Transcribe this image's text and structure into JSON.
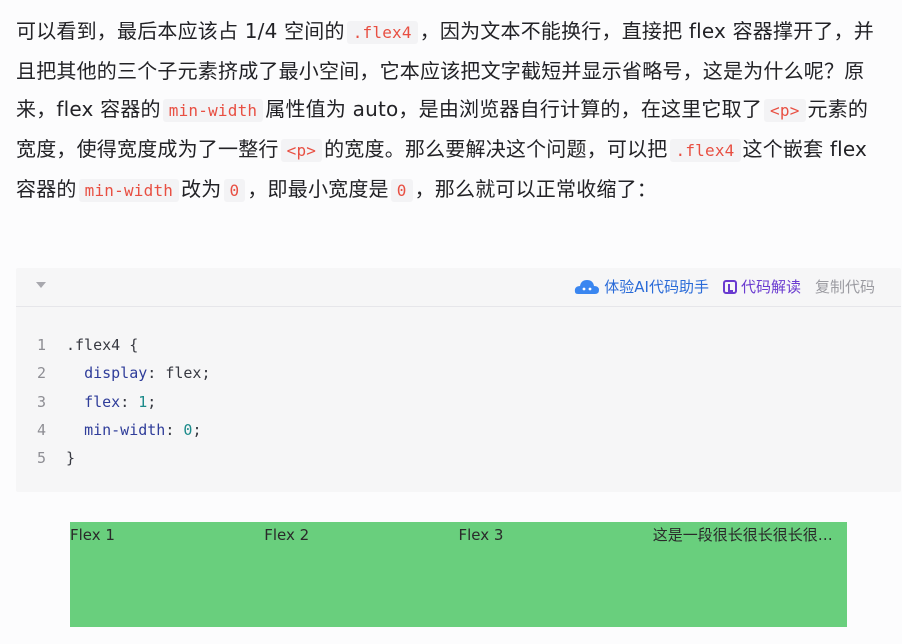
{
  "paragraph": {
    "t1": "可以看到，最后本应该占 1/4 空间的",
    "c1": ".flex4",
    "t2": "，因为文本不能换行，直接把 flex 容器撑开了，并且把其他的三个子元素挤成了最小空间，它本应该把文字截短并显示省略号，这是为什么呢？原来，flex 容器的",
    "c2": "min-width",
    "t3": "属性值为 auto，是由浏览器自行计算的，在这里它取了",
    "c3": "<p>",
    "t4": "元素的宽度，使得宽度成为了一整行",
    "c4": "<p>",
    "t5": "的宽度。那么要解决这个问题，可以把",
    "c5": ".flex4",
    "t6": "这个嵌套 flex 容器的",
    "c6": "min-width",
    "t7": "改为",
    "c7": "0",
    "t8": "，即最小宽度是",
    "c8": "0",
    "t9": "，那么就可以正常收缩了："
  },
  "code_toolbar": {
    "ai_label": "体验AI代码助手",
    "explain_label": "代码解读",
    "copy_label": "复制代码",
    "icons": [
      "chevron-down-icon",
      "cloud-ai-icon",
      "code-explain-icon"
    ]
  },
  "code": {
    "numbers": [
      "1",
      "2",
      "3",
      "4",
      "5"
    ],
    "l1_sel": ".flex4 {",
    "l2_prop": "display",
    "l2_val": "flex",
    "l3_prop": "flex",
    "l3_val": "1",
    "l4_prop": "min-width",
    "l4_val": "0",
    "l5": "}"
  },
  "demo": {
    "items": [
      "Flex 1",
      "Flex 2",
      "Flex 3",
      "这是一段很长很长很长很长很长很长很长很长很长很长很长很长很长很长很长很长很长很长很长很长的文本"
    ],
    "background": "#69cf7d"
  },
  "colors": {
    "inline_code": "#e84f42",
    "ai_link": "#2a6bd8",
    "explain_link": "#6a3bd0",
    "copy_link": "#9b9ba1"
  }
}
